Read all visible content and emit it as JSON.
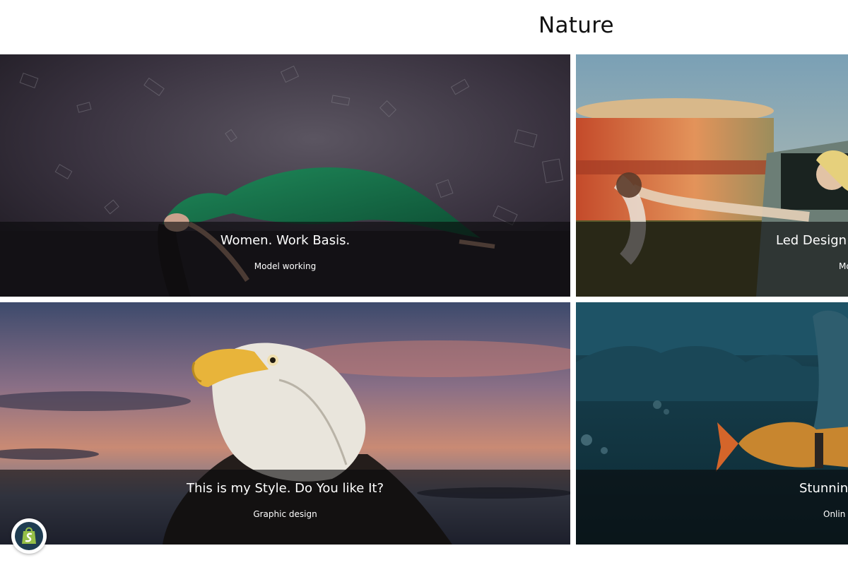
{
  "page": {
    "heading": "Nature"
  },
  "gallery": {
    "items": [
      {
        "title": "Women. Work Basis.",
        "subtitle": "Model working"
      },
      {
        "title": "Led Design.",
        "subtitle": "Mo"
      },
      {
        "title": "This is my Style. Do You like It?",
        "subtitle": "Graphic design"
      },
      {
        "title": "Stunnin",
        "subtitle": "Onlin"
      }
    ]
  },
  "badge": {
    "icon": "shopify-bag-icon",
    "color": "#95bf47"
  },
  "colors": {
    "caption_overlay": "#0a0a0c",
    "caption_text": "#ffffff",
    "heading_text": "#111111"
  }
}
